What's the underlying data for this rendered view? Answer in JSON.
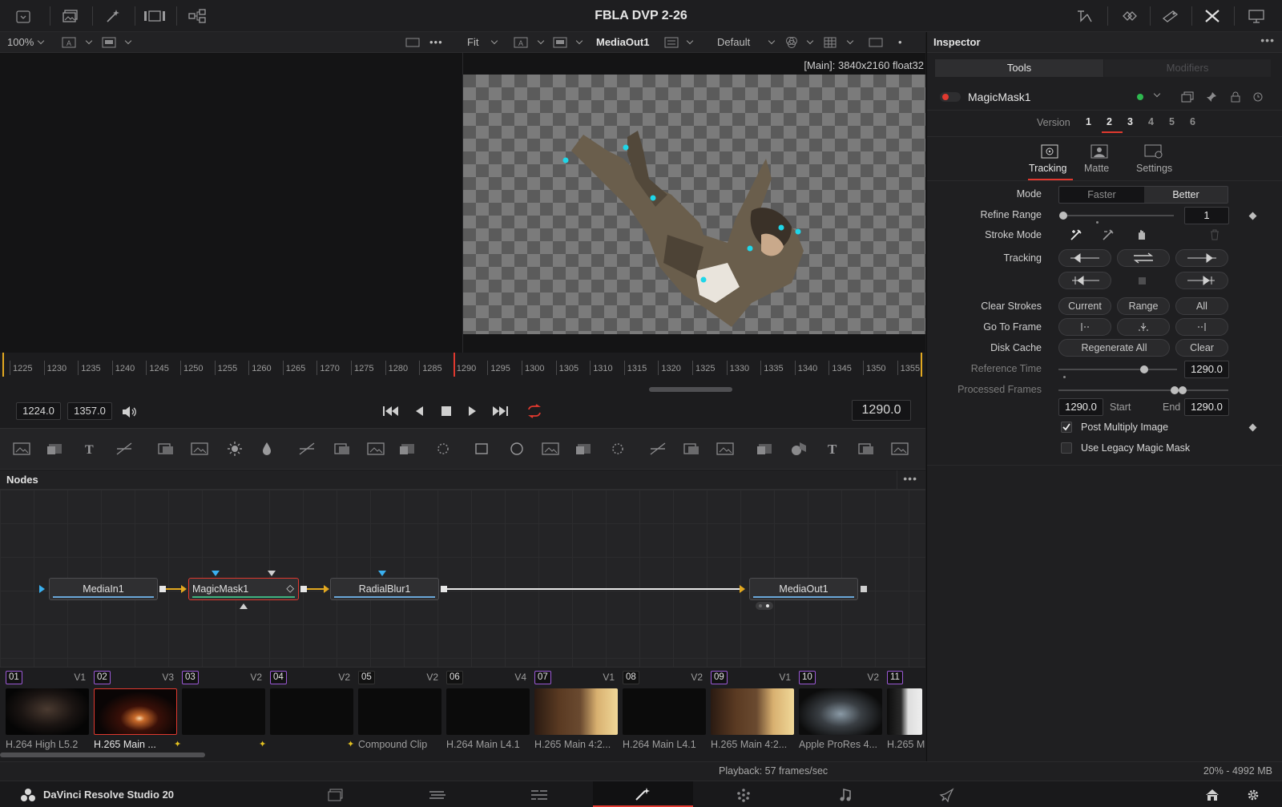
{
  "app": {
    "title": "FBLA DVP 2-26",
    "brand": "DaVinci Resolve Studio 20"
  },
  "viewer_left": {
    "zoom": "100%"
  },
  "viewer_right": {
    "zoom": "Fit",
    "node": "MediaOut1",
    "lut": "Default",
    "info": "[Main]: 3840x2160 float32"
  },
  "timeline": {
    "ticks": [
      "1225",
      "1230",
      "1235",
      "1240",
      "1245",
      "1250",
      "1255",
      "1260",
      "1265",
      "1270",
      "1275",
      "1280",
      "1285",
      "1290",
      "1295",
      "1300",
      "1305",
      "1310",
      "1315",
      "1320",
      "1325",
      "1330",
      "1335",
      "1340",
      "1345",
      "1350",
      "1355"
    ],
    "start": "1224.0",
    "end": "1357.0",
    "current": "1290.0"
  },
  "nodes": {
    "title": "Nodes",
    "items": [
      "MediaIn1",
      "MagicMask1",
      "RadialBlur1",
      "MediaOut1"
    ]
  },
  "media": [
    {
      "num": "01",
      "track": "V1",
      "name": "H.264 High L5.2",
      "color": "#9b59d6"
    },
    {
      "num": "02",
      "track": "V3",
      "name": "H.265 Main ...",
      "color": "#9b59d6"
    },
    {
      "num": "03",
      "track": "V2",
      "name": "",
      "color": "#9b59d6"
    },
    {
      "num": "04",
      "track": "V2",
      "name": "",
      "color": "#9b59d6"
    },
    {
      "num": "05",
      "track": "V2",
      "name": "Compound Clip",
      "color": "#333333"
    },
    {
      "num": "06",
      "track": "V4",
      "name": "H.264 Main L4.1",
      "color": "#333333"
    },
    {
      "num": "07",
      "track": "V1",
      "name": "H.265 Main 4:2...",
      "color": "#9b59d6"
    },
    {
      "num": "08",
      "track": "V2",
      "name": "H.264 Main L4.1",
      "color": "#333333"
    },
    {
      "num": "09",
      "track": "V1",
      "name": "H.265 Main 4:2...",
      "color": "#9b59d6"
    },
    {
      "num": "10",
      "track": "V2",
      "name": "Apple ProRes 4...",
      "color": "#9b59d6"
    },
    {
      "num": "11",
      "track": "",
      "name": "H.265 M",
      "color": "#9b59d6"
    }
  ],
  "status": {
    "playback": "Playback: 57 frames/sec",
    "memory": "20% - 4992 MB"
  },
  "inspector": {
    "title": "Inspector",
    "tab_tools": "Tools",
    "tab_modifiers": "Modifiers",
    "tool_name": "MagicMask1",
    "version_label": "Version",
    "versions": [
      "1",
      "2",
      "3",
      "4",
      "5",
      "6"
    ],
    "subtabs": [
      "Tracking",
      "Matte",
      "Settings"
    ],
    "mode_label": "Mode",
    "mode_faster": "Faster",
    "mode_better": "Better",
    "refine_label": "Refine Range",
    "refine_value": "1",
    "refine_level": 0.0,
    "stroke_label": "Stroke Mode",
    "tracking_label": "Tracking",
    "clear_label": "Clear Strokes",
    "clear_current": "Current",
    "clear_range": "Range",
    "clear_all": "All",
    "goto_label": "Go To Frame",
    "disk_label": "Disk Cache",
    "regen": "Regenerate All",
    "clear": "Clear",
    "ref_label": "Reference Time",
    "ref_value": "1290.0",
    "proc_label": "Processed Frames",
    "proc_start": "1290.0",
    "start_label": "Start",
    "end_label": "End",
    "proc_end": "1290.0",
    "postmult": "Post Multiply Image",
    "legacy": "Use Legacy Magic Mask",
    "postmult_checked": true,
    "legacy_checked": false
  },
  "colors": {
    "accent": "#e0392f",
    "track_point": "#1fd6e8",
    "conn": "#e2a820"
  }
}
